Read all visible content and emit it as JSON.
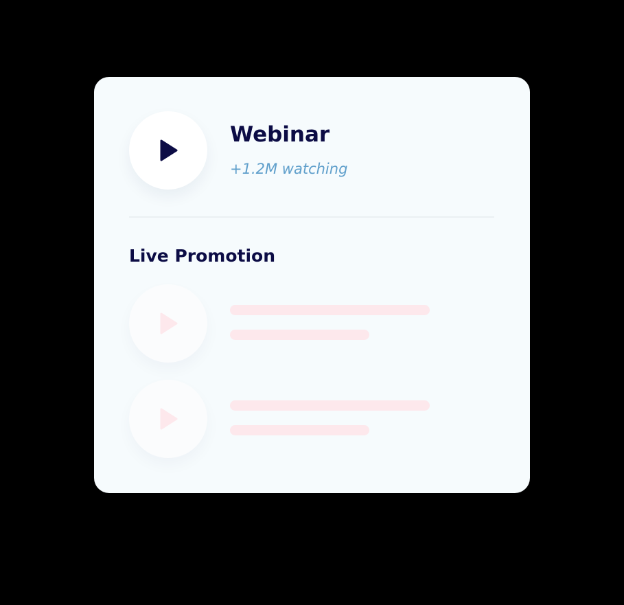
{
  "webinar": {
    "title": "Webinar",
    "watching": "+1.2M watching",
    "icon": "play-icon",
    "icon_color": "#0c0c45"
  },
  "live_promotion": {
    "title": "Live Promotion",
    "items": [
      {
        "icon": "play-icon",
        "state": "placeholder"
      },
      {
        "icon": "play-icon",
        "state": "placeholder"
      }
    ],
    "placeholder_icon_color": "#fde8ec",
    "skeleton_color": "#fde8ec"
  },
  "colors": {
    "page_background": "#000000",
    "card_background": "#f6fbfd",
    "title_color": "#0c0c45",
    "subtitle_color": "#5f9fcb"
  }
}
